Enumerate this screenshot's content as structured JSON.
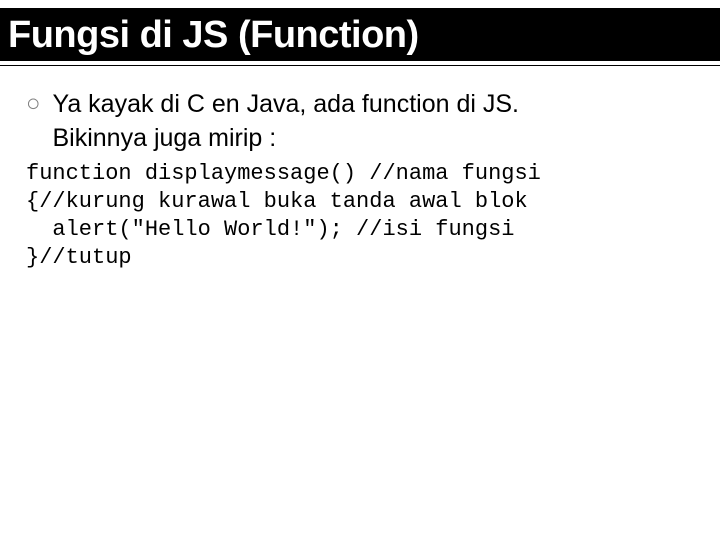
{
  "title": "Fungsi di JS (Function)",
  "bullet_marker": "○",
  "bullet_line1": "Ya kayak di C en Java, ada function di JS.",
  "bullet_line2": "Bikinnya juga mirip :",
  "code_l1": "function displaymessage() //nama fungsi",
  "code_l2": "{//kurung kurawal buka tanda awal blok",
  "code_l3": "  alert(\"Hello World!\"); //isi fungsi",
  "code_l4": "}//tutup"
}
